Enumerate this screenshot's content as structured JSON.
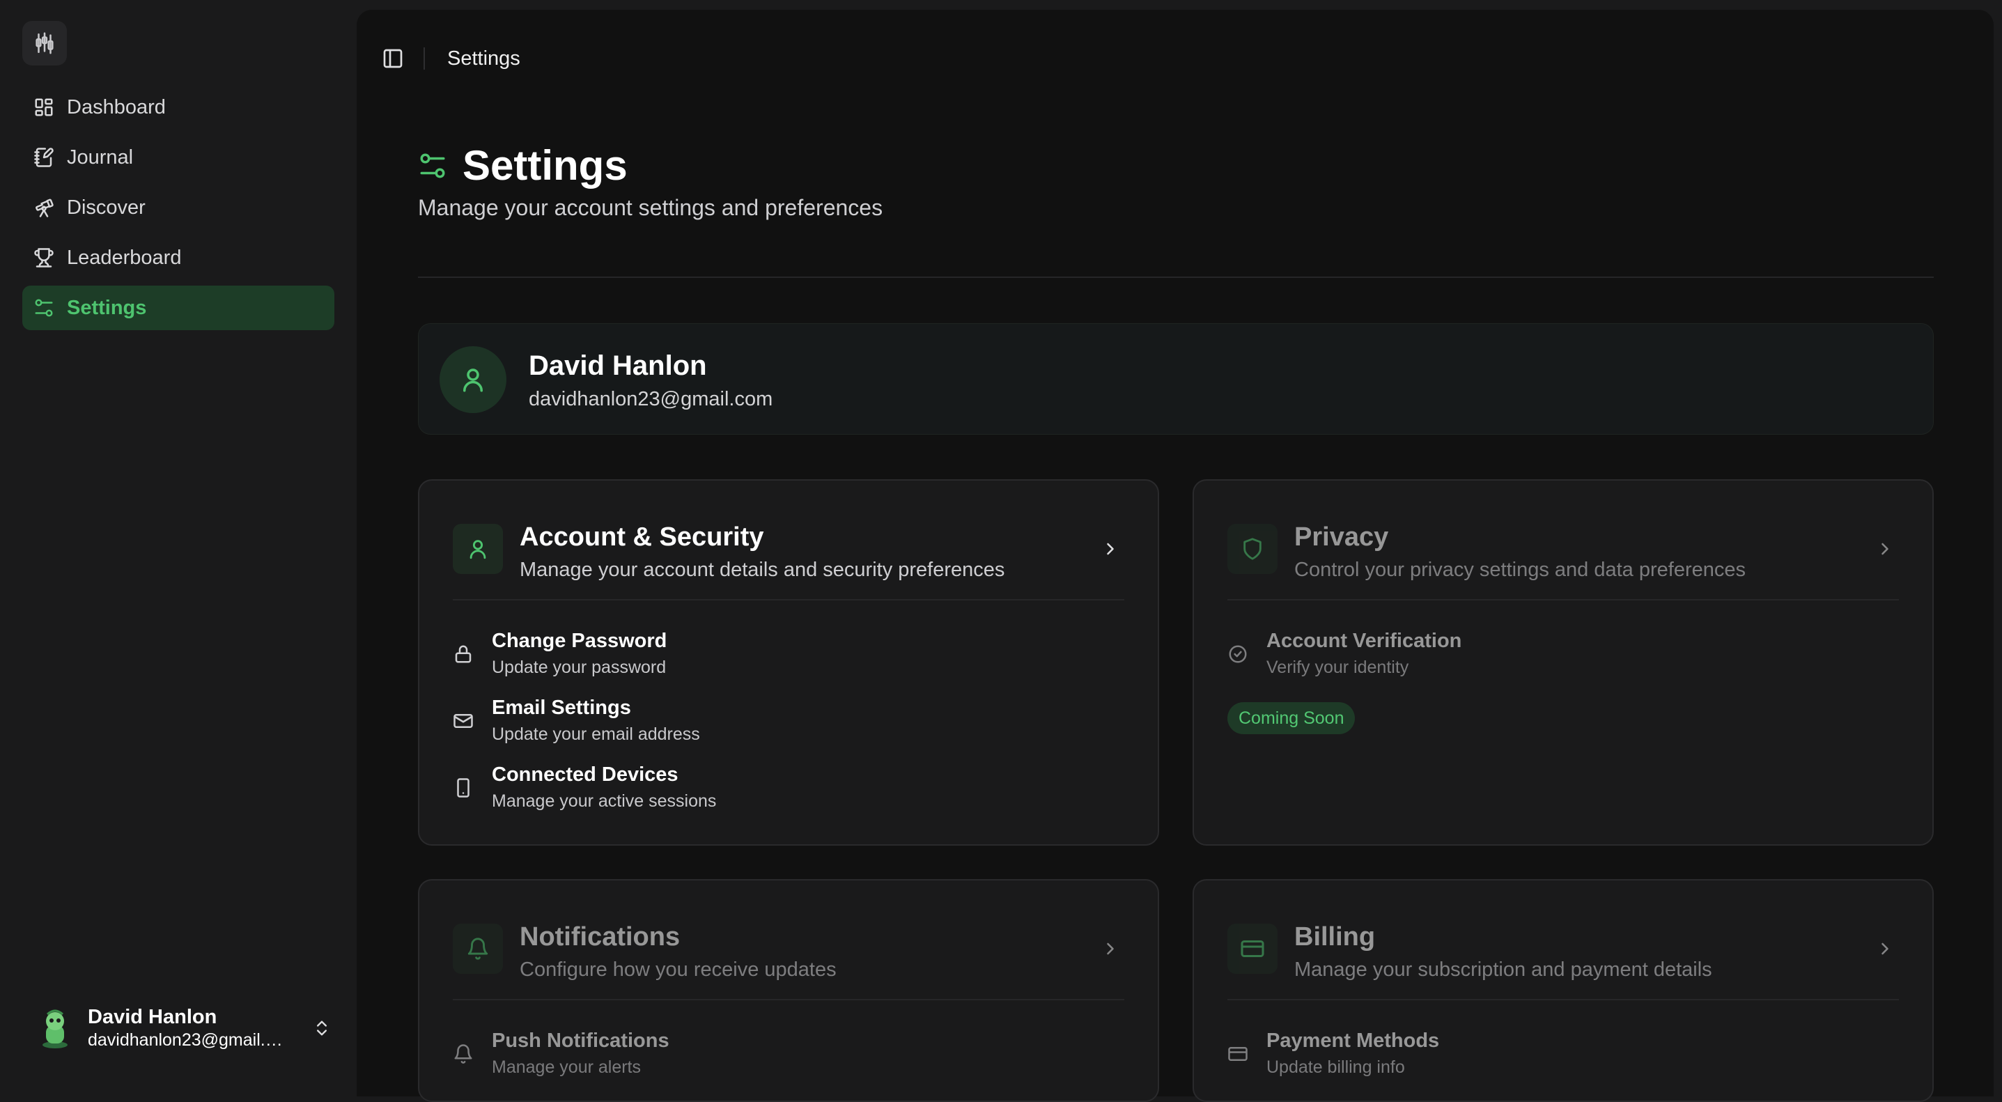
{
  "colors": {
    "accent": "#4ec46f",
    "active_bg": "#1d3d27",
    "panel": "#111111",
    "card": "#1a1a1b"
  },
  "sidebar": {
    "logo_icon": "candlestick-chart-icon",
    "items": [
      {
        "label": "Dashboard",
        "icon": "grid-icon",
        "active": false
      },
      {
        "label": "Journal",
        "icon": "notebook-pen-icon",
        "active": false
      },
      {
        "label": "Discover",
        "icon": "telescope-icon",
        "active": false
      },
      {
        "label": "Leaderboard",
        "icon": "trophy-icon",
        "active": false
      },
      {
        "label": "Settings",
        "icon": "sliders-icon",
        "active": true
      }
    ],
    "user": {
      "name": "David Hanlon",
      "email": "davidhanlon23@gmail.com"
    }
  },
  "header": {
    "breadcrumb": "Settings"
  },
  "page": {
    "title": "Settings",
    "subtitle": "Manage your account settings and preferences"
  },
  "profile": {
    "name": "David Hanlon",
    "email": "davidhanlon23@gmail.com"
  },
  "cards": {
    "account": {
      "title": "Account & Security",
      "description": "Manage your account details and security preferences",
      "rows": [
        {
          "title": "Change Password",
          "subtitle": "Update your password",
          "icon": "lock-icon"
        },
        {
          "title": "Email Settings",
          "subtitle": "Update your email address",
          "icon": "mail-icon"
        },
        {
          "title": "Connected Devices",
          "subtitle": "Manage your active sessions",
          "icon": "smartphone-icon"
        }
      ]
    },
    "privacy": {
      "title": "Privacy",
      "description": "Control your privacy settings and data preferences",
      "rows": [
        {
          "title": "Account Verification",
          "subtitle": "Verify your identity",
          "icon": "check-circle-icon"
        }
      ],
      "badge": "Coming Soon"
    },
    "notifications": {
      "title": "Notifications",
      "description": "Configure how you receive updates",
      "rows": [
        {
          "title": "Push Notifications",
          "subtitle": "Manage your alerts",
          "icon": "bell-icon"
        }
      ]
    },
    "billing": {
      "title": "Billing",
      "description": "Manage your subscription and payment details",
      "rows": [
        {
          "title": "Payment Methods",
          "subtitle": "Update billing info",
          "icon": "credit-card-icon"
        }
      ]
    }
  }
}
